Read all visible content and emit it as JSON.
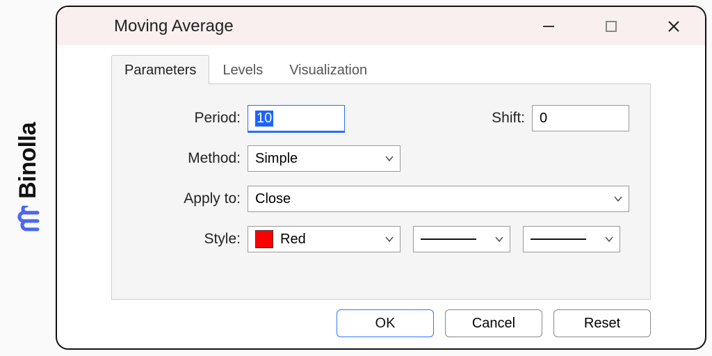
{
  "brand": {
    "name": "Binolla",
    "icon_color": "#4a66f4"
  },
  "window": {
    "title": "Moving Average",
    "tabs": [
      {
        "id": "parameters",
        "label": "Parameters",
        "active": true
      },
      {
        "id": "levels",
        "label": "Levels",
        "active": false
      },
      {
        "id": "visualization",
        "label": "Visualization",
        "active": false
      }
    ],
    "fields": {
      "period": {
        "label": "Period:",
        "value": "10"
      },
      "shift": {
        "label": "Shift:",
        "value": "0"
      },
      "method": {
        "label": "Method:",
        "value": "Simple"
      },
      "apply": {
        "label": "Apply to:",
        "value": "Close"
      },
      "style": {
        "label": "Style:",
        "color_name": "Red",
        "color_hex": "#fd0000"
      }
    },
    "buttons": {
      "ok": "OK",
      "cancel": "Cancel",
      "reset": "Reset"
    }
  }
}
